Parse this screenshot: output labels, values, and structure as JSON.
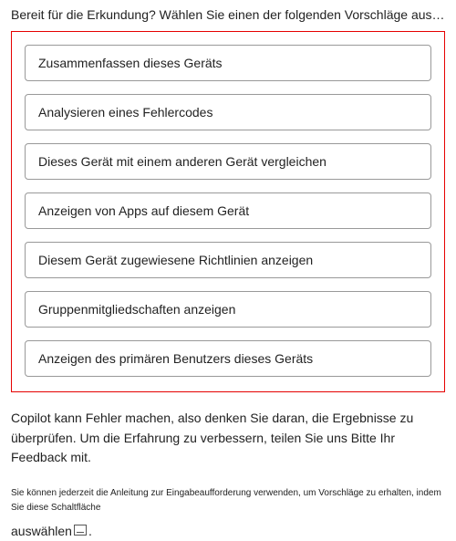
{
  "intro": "Bereit für die Erkundung? Wählen Sie einen der folgenden Vorschläge aus, um zu beginnen...",
  "suggestions": [
    "Zusammenfassen dieses Geräts",
    "Analysieren eines Fehlercodes",
    "Dieses Gerät mit einem anderen Gerät vergleichen",
    "Anzeigen von Apps auf diesem Gerät",
    "Diesem Gerät zugewiesene Richtlinien anzeigen",
    "Gruppenmitgliedschaften anzeigen",
    "Anzeigen des primären Benutzers dieses Geräts"
  ],
  "note": "Copilot kann Fehler machen, also denken Sie daran, die Ergebnisse zu überprüfen. Um die Erfahrung zu verbessern, teilen Sie uns Bitte Ihr Feedback mit.",
  "hint_small": "Sie können jederzeit die Anleitung zur Eingabeaufforderung verwenden, um Vorschläge zu erhalten, indem Sie diese Schaltfläche",
  "hint_select_word": "auswählen",
  "hint_period": "."
}
